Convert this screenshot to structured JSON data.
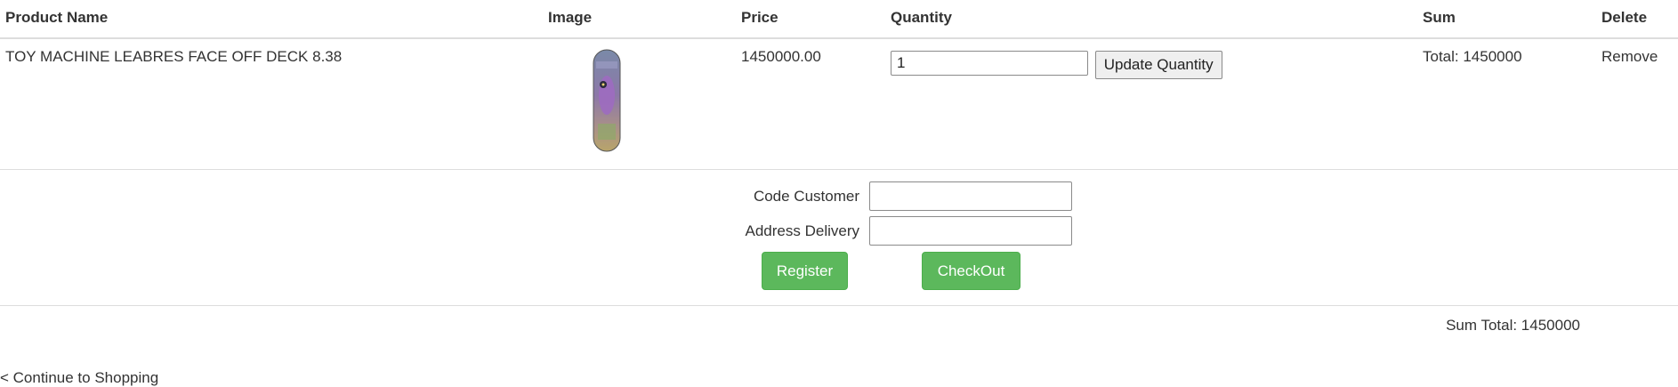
{
  "table": {
    "headers": {
      "product_name": "Product Name",
      "image": "Image",
      "price": "Price",
      "quantity": "Quantity",
      "sum": "Sum",
      "delete": "Delete"
    },
    "rows": [
      {
        "product_name": "TOY MACHINE LEABRES FACE OFF DECK 8.38",
        "price": "1450000.00",
        "quantity": "1",
        "update_label": "Update Quantity",
        "sum": "Total: 1450000",
        "remove_label": "Remove"
      }
    ]
  },
  "form": {
    "code_customer_label": "Code Customer",
    "address_delivery_label": "Address Delivery",
    "code_customer_value": "",
    "address_delivery_value": "",
    "register_label": "Register",
    "checkout_label": "CheckOut"
  },
  "sum_total": "Sum Total: 1450000",
  "continue_link": "< Continue to Shopping",
  "colors": {
    "accent_green": "#5cb85c",
    "border": "#dddddd",
    "text": "#333333"
  }
}
